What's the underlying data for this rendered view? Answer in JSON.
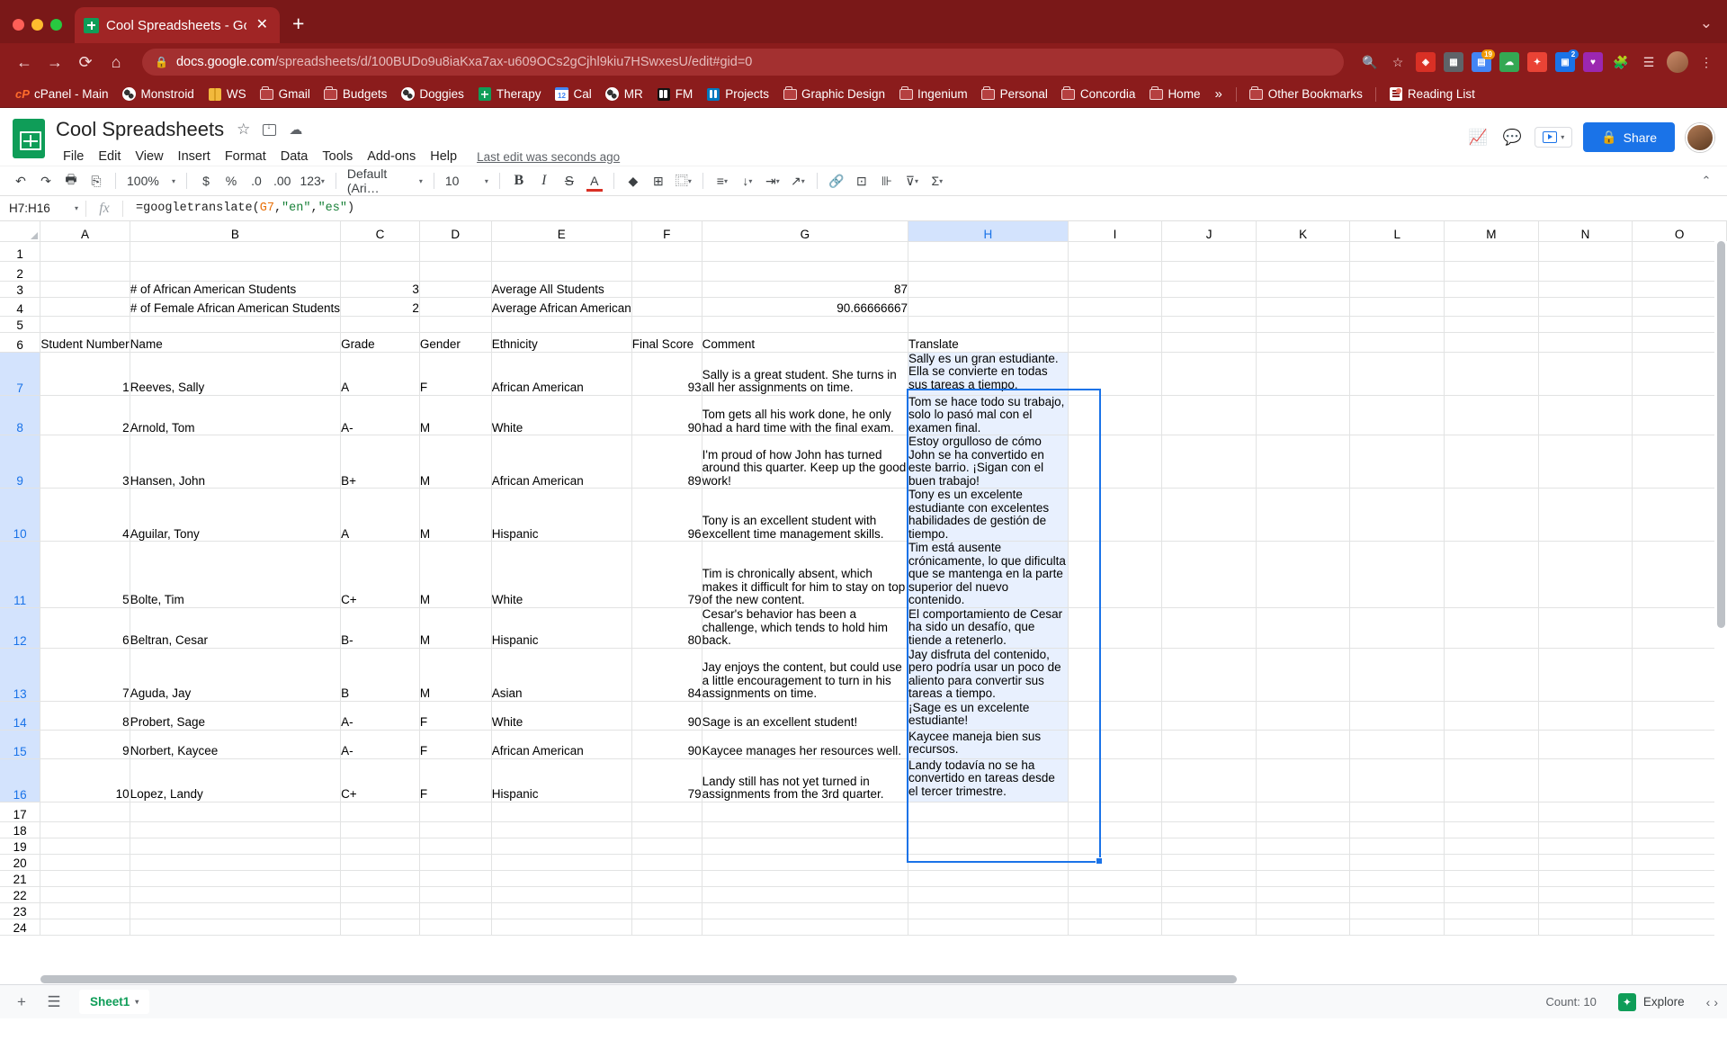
{
  "browser": {
    "tab_title": "Cool Spreadsheets - Google Sh",
    "new_tab_label": "+",
    "close_label": "✕",
    "url_prefix": "docs.google.com",
    "url_suffix": "/spreadsheets/d/100BUDo9u8iaKxa7ax-u609OCs2gCjhl9kiu7HSwxesU/edit#gid=0",
    "nav": {
      "back": "←",
      "forward": "→",
      "reload": "⟳",
      "home": "⌂"
    },
    "omni_icons": [
      "search-icon",
      "star-icon",
      "shield-icon",
      "grid-icon",
      "calendar-icon",
      "cloud-icon",
      "puzzle-icon",
      "pin-icon",
      "heart-icon",
      "extension-icon",
      "list-icon",
      "profile-icon",
      "menu-icon"
    ],
    "badges": {
      "calendar": "19",
      "list": "2"
    },
    "bookmarks": [
      {
        "label": "cPanel - Main",
        "icon": "cpanel-icon"
      },
      {
        "label": "Monstroid",
        "icon": "globe-icon"
      },
      {
        "label": "WS",
        "icon": "box-icon"
      },
      {
        "label": "Gmail",
        "icon": "folder-icon"
      },
      {
        "label": "Budgets",
        "icon": "folder-icon"
      },
      {
        "label": "Doggies",
        "icon": "globe-icon"
      },
      {
        "label": "Therapy",
        "icon": "sheets-icon"
      },
      {
        "label": "Cal",
        "icon": "calendar-icon"
      },
      {
        "label": "MR",
        "icon": "globe-icon"
      },
      {
        "label": "FM",
        "icon": "trello-dark-icon"
      },
      {
        "label": "Projects",
        "icon": "trello-blue-icon"
      },
      {
        "label": "Graphic Design",
        "icon": "folder-icon"
      },
      {
        "label": "Ingenium",
        "icon": "folder-icon"
      },
      {
        "label": "Personal",
        "icon": "folder-icon"
      },
      {
        "label": "Concordia",
        "icon": "folder-icon"
      },
      {
        "label": "Home",
        "icon": "folder-icon"
      }
    ],
    "bookmarks_overflow": "»",
    "other_bookmarks": "Other Bookmarks",
    "reading_list": "Reading List"
  },
  "sheets": {
    "doc_title": "Cool Spreadsheets",
    "title_icons": [
      "star-icon",
      "move-to-folder-icon",
      "cloud-status-icon"
    ],
    "menus": [
      "File",
      "Edit",
      "View",
      "Insert",
      "Format",
      "Data",
      "Tools",
      "Add-ons",
      "Help"
    ],
    "last_edit": "Last edit was seconds ago",
    "header_icons": [
      "trending-icon",
      "comment-icon"
    ],
    "present_label": "",
    "share_label": "Share",
    "toolbar": {
      "undo": "↶",
      "redo": "↷",
      "print": "🖶",
      "paint": "⎘",
      "zoom": "100%",
      "currency": "$",
      "percent": "%",
      "dec_less": ".0",
      "dec_more": ".00",
      "formats": "123",
      "font": "Default (Ari…",
      "font_size": "10",
      "bold": "B",
      "italic": "I",
      "strikethrough": "S",
      "text_color": "A",
      "fill_color": "◆",
      "borders": "⊞",
      "merge": "⿴",
      "halign": "≡",
      "valign": "↓",
      "wrap": "⇥",
      "rotate": "↗",
      "link": "🔗",
      "comment": "⊡",
      "chart": "⊪",
      "filter": "⊽",
      "functions": "Σ",
      "collapse": "⌃"
    },
    "formula_bar": {
      "name_box": "H7:H16",
      "fx": "fx",
      "formula_start": "=googletranslate(",
      "formula_ref": "G7",
      "formula_comma1": ",",
      "formula_s1": "\"en\"",
      "formula_comma2": ",",
      "formula_s2": "\"es\"",
      "formula_end": ")"
    },
    "columns": [
      "A",
      "B",
      "C",
      "D",
      "E",
      "F",
      "G",
      "H",
      "I",
      "J",
      "K",
      "L",
      "M",
      "N",
      "O"
    ],
    "selected_column": "H",
    "row_numbers": [
      "1",
      "2",
      "3",
      "4",
      "5",
      "6",
      "7",
      "8",
      "9",
      "10",
      "11",
      "12",
      "13",
      "14",
      "15",
      "16",
      "17",
      "18",
      "19",
      "20",
      "21",
      "22",
      "23",
      "24"
    ],
    "selected_rows": [
      "7",
      "8",
      "9",
      "10",
      "11",
      "12",
      "13",
      "14",
      "15",
      "16"
    ],
    "summary": {
      "label_african_american": "# of African American Students",
      "value_african_american": "3",
      "label_female_african_american": "# of Female African American Students",
      "value_female_african_american": "2",
      "label_avg_all": "Average All Students",
      "value_avg_all": "87",
      "label_avg_aa": "Average African American",
      "value_avg_aa": "90.66666667"
    },
    "headers": {
      "student_number": "Student Number",
      "name": "Name",
      "grade": "Grade",
      "gender": "Gender",
      "ethnicity": "Ethnicity",
      "final_score": "Final Score",
      "comment": "Comment",
      "translate": "Translate"
    },
    "rows": [
      {
        "num": "1",
        "name": "Reeves, Sally",
        "grade": "A",
        "gender": "F",
        "ethnicity": "African American",
        "score": "93",
        "comment": "Sally is a great student. She turns in all her assignments on time.",
        "translate": "Sally es un gran estudiante. Ella se convierte en todas sus tareas a tiempo."
      },
      {
        "num": "2",
        "name": "Arnold, Tom",
        "grade": "A-",
        "gender": "M",
        "ethnicity": "White",
        "score": "90",
        "comment": "Tom gets all his work done, he only had a hard time with the final exam.",
        "translate": "Tom se hace todo su trabajo, solo lo pasó mal con el examen final."
      },
      {
        "num": "3",
        "name": "Hansen, John",
        "grade": "B+",
        "gender": "M",
        "ethnicity": "African American",
        "score": "89",
        "comment": "I'm proud of how John has turned around this quarter. Keep up the good work!",
        "translate": "Estoy orgulloso de cómo John se ha convertido en este barrio. ¡Sigan con el buen trabajo!"
      },
      {
        "num": "4",
        "name": "Aguilar, Tony",
        "grade": "A",
        "gender": "M",
        "ethnicity": "Hispanic",
        "score": "96",
        "comment": "Tony is an excellent student with excellent time management skills.",
        "translate": "Tony es un excelente estudiante con excelentes habilidades de gestión de tiempo."
      },
      {
        "num": "5",
        "name": "Bolte, Tim",
        "grade": "C+",
        "gender": "M",
        "ethnicity": "White",
        "score": "79",
        "comment": "Tim is chronically absent, which makes it difficult for him to stay on top of the new content.",
        "translate": "Tim está ausente crónicamente, lo que dificulta que se mantenga en la parte superior del nuevo contenido."
      },
      {
        "num": "6",
        "name": "Beltran, Cesar",
        "grade": "B-",
        "gender": "M",
        "ethnicity": "Hispanic",
        "score": "80",
        "comment": "Cesar's behavior has been a challenge, which tends to hold him back.",
        "translate": "El comportamiento de Cesar ha sido un desafío, que tiende a retenerlo."
      },
      {
        "num": "7",
        "name": "Aguda, Jay",
        "grade": "B",
        "gender": "M",
        "ethnicity": "Asian",
        "score": "84",
        "comment": "Jay enjoys the content, but could use a little encouragement to turn in his assignments on time.",
        "translate": "Jay disfruta del contenido, pero podría usar un poco de aliento para convertir sus tareas a tiempo."
      },
      {
        "num": "8",
        "name": "Probert, Sage",
        "grade": "A-",
        "gender": "F",
        "ethnicity": "White",
        "score": "90",
        "comment": "Sage is an excellent student!",
        "translate": "¡Sage es un excelente estudiante!"
      },
      {
        "num": "9",
        "name": "Norbert, Kaycee",
        "grade": "A-",
        "gender": "F",
        "ethnicity": "African American",
        "score": "90",
        "comment": "Kaycee manages her resources well.",
        "translate": "Kaycee maneja bien sus recursos."
      },
      {
        "num": "10",
        "name": "Lopez, Landy",
        "grade": "C+",
        "gender": "F",
        "ethnicity": "Hispanic",
        "score": "79",
        "comment": "Landy still has not yet turned in assignments from the 3rd quarter.",
        "translate": "Landy todavía no se ha convertido en tareas desde el tercer trimestre."
      }
    ],
    "bottom": {
      "add_sheet": "+",
      "all_sheets": "☰",
      "sheet_name": "Sheet1",
      "sheet_caret": "▾",
      "count": "Count: 10",
      "explore": "Explore",
      "nav_left": "‹",
      "nav_right": "›"
    }
  },
  "colors": {
    "chrome_theme": "#8b1c1c",
    "sheets_green": "#0f9d58",
    "accent_blue": "#1a73e8",
    "selection_fill": "#e8f0fe"
  }
}
